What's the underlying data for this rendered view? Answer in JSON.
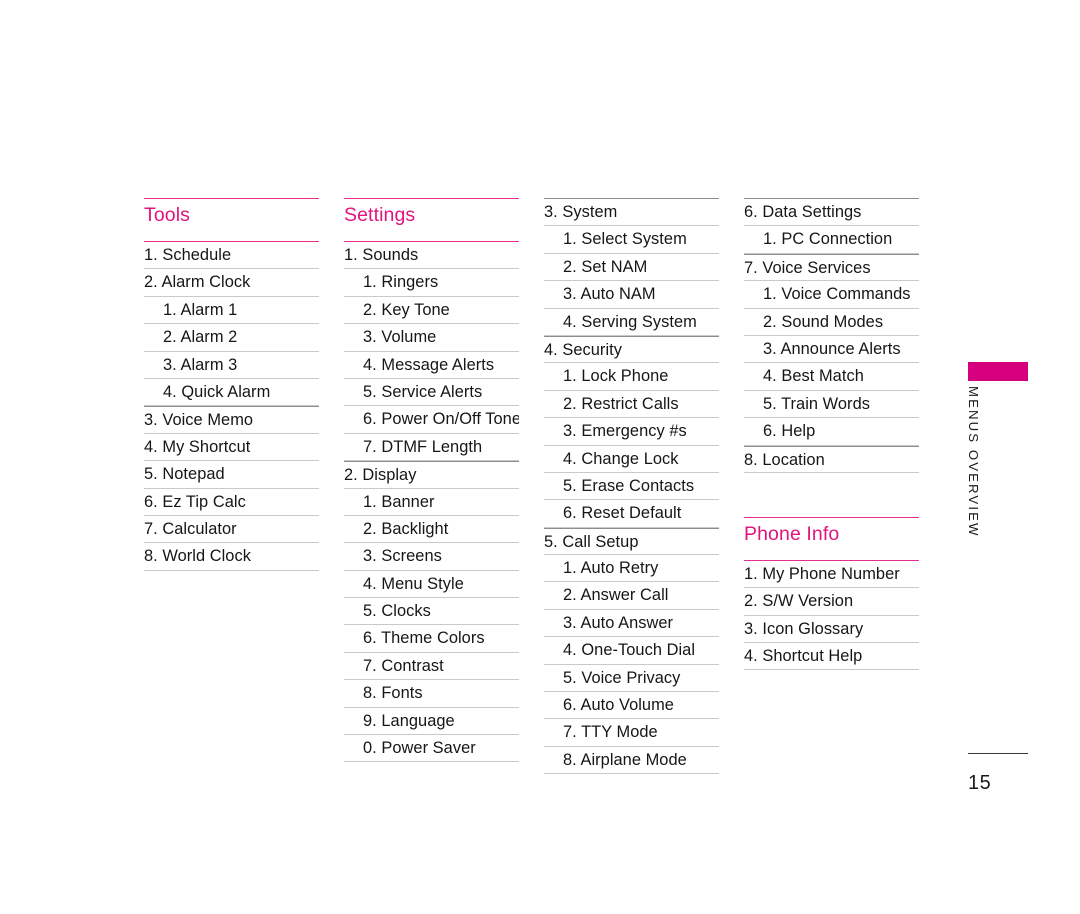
{
  "page": {
    "number": "15",
    "side_tab_label": "MENUS OVERVIEW",
    "accent_color": "#d6007e",
    "header_rule_color": "#e62e8e",
    "header_text_color": "#e1147f",
    "body_text_color": "#161616"
  },
  "columns": [
    {
      "id": "column-1",
      "header": "Tools",
      "continued": false,
      "items": [
        {
          "label": "1. Schedule",
          "level": 1
        },
        {
          "label": "2. Alarm Clock",
          "level": 1
        },
        {
          "label": "1. Alarm 1",
          "level": 2
        },
        {
          "label": "2. Alarm 2",
          "level": 2
        },
        {
          "label": "3. Alarm 3",
          "level": 2
        },
        {
          "label": "4. Quick Alarm",
          "level": 2
        },
        {
          "label": "3. Voice Memo",
          "level": 1
        },
        {
          "label": "4. My Shortcut",
          "level": 1
        },
        {
          "label": "5. Notepad",
          "level": 1
        },
        {
          "label": "6. Ez Tip Calc",
          "level": 1
        },
        {
          "label": "7. Calculator",
          "level": 1
        },
        {
          "label": "8. World Clock",
          "level": 1
        }
      ]
    },
    {
      "id": "column-2",
      "header": "Settings",
      "continued": false,
      "items": [
        {
          "label": "1. Sounds",
          "level": 1
        },
        {
          "label": "1. Ringers",
          "level": 2
        },
        {
          "label": "2. Key Tone",
          "level": 2
        },
        {
          "label": "3. Volume",
          "level": 2
        },
        {
          "label": "4. Message Alerts",
          "level": 2
        },
        {
          "label": "5. Service Alerts",
          "level": 2
        },
        {
          "label": "6. Power On/Off Tone",
          "level": 2
        },
        {
          "label": "7. DTMF Length",
          "level": 2
        },
        {
          "label": "2. Display",
          "level": 1
        },
        {
          "label": "1. Banner",
          "level": 2
        },
        {
          "label": "2. Backlight",
          "level": 2
        },
        {
          "label": "3. Screens",
          "level": 2
        },
        {
          "label": "4. Menu Style",
          "level": 2
        },
        {
          "label": "5. Clocks",
          "level": 2
        },
        {
          "label": "6. Theme Colors",
          "level": 2
        },
        {
          "label": "7. Contrast",
          "level": 2
        },
        {
          "label": "8. Fonts",
          "level": 2
        },
        {
          "label": "9. Language",
          "level": 2
        },
        {
          "label": "0. Power Saver",
          "level": 2
        }
      ]
    },
    {
      "id": "column-3",
      "header": null,
      "continued": true,
      "items": [
        {
          "label": "3. System",
          "level": 1
        },
        {
          "label": "1. Select System",
          "level": 2
        },
        {
          "label": "2. Set NAM",
          "level": 2
        },
        {
          "label": "3. Auto NAM",
          "level": 2
        },
        {
          "label": "4. Serving System",
          "level": 2
        },
        {
          "label": "4. Security",
          "level": 1
        },
        {
          "label": "1. Lock Phone",
          "level": 2
        },
        {
          "label": "2. Restrict Calls",
          "level": 2
        },
        {
          "label": "3. Emergency #s",
          "level": 2
        },
        {
          "label": "4. Change Lock",
          "level": 2
        },
        {
          "label": "5. Erase Contacts",
          "level": 2
        },
        {
          "label": "6. Reset Default",
          "level": 2
        },
        {
          "label": "5. Call Setup",
          "level": 1
        },
        {
          "label": "1. Auto Retry",
          "level": 2
        },
        {
          "label": "2. Answer Call",
          "level": 2
        },
        {
          "label": "3. Auto Answer",
          "level": 2
        },
        {
          "label": "4. One-Touch Dial",
          "level": 2
        },
        {
          "label": "5. Voice Privacy",
          "level": 2
        },
        {
          "label": "6. Auto Volume",
          "level": 2
        },
        {
          "label": "7. TTY Mode",
          "level": 2
        },
        {
          "label": "8. Airplane Mode",
          "level": 2
        }
      ]
    },
    {
      "id": "column-4",
      "header": null,
      "continued": true,
      "items": [
        {
          "label": "6. Data Settings",
          "level": 1
        },
        {
          "label": "1. PC Connection",
          "level": 2
        },
        {
          "label": "7. Voice Services",
          "level": 1
        },
        {
          "label": "1. Voice Commands",
          "level": 2
        },
        {
          "label": "2. Sound Modes",
          "level": 2
        },
        {
          "label": "3. Announce Alerts",
          "level": 2
        },
        {
          "label": "4. Best Match",
          "level": 2
        },
        {
          "label": "5. Train Words",
          "level": 2
        },
        {
          "label": "6. Help",
          "level": 2
        },
        {
          "label": "8. Location",
          "level": 1
        }
      ],
      "second_section": {
        "header": "Phone Info",
        "items": [
          {
            "label": "1. My Phone Number",
            "level": 1
          },
          {
            "label": "2. S/W Version",
            "level": 1
          },
          {
            "label": "3. Icon Glossary",
            "level": 1
          },
          {
            "label": "4. Shortcut Help",
            "level": 1
          }
        ]
      }
    }
  ]
}
